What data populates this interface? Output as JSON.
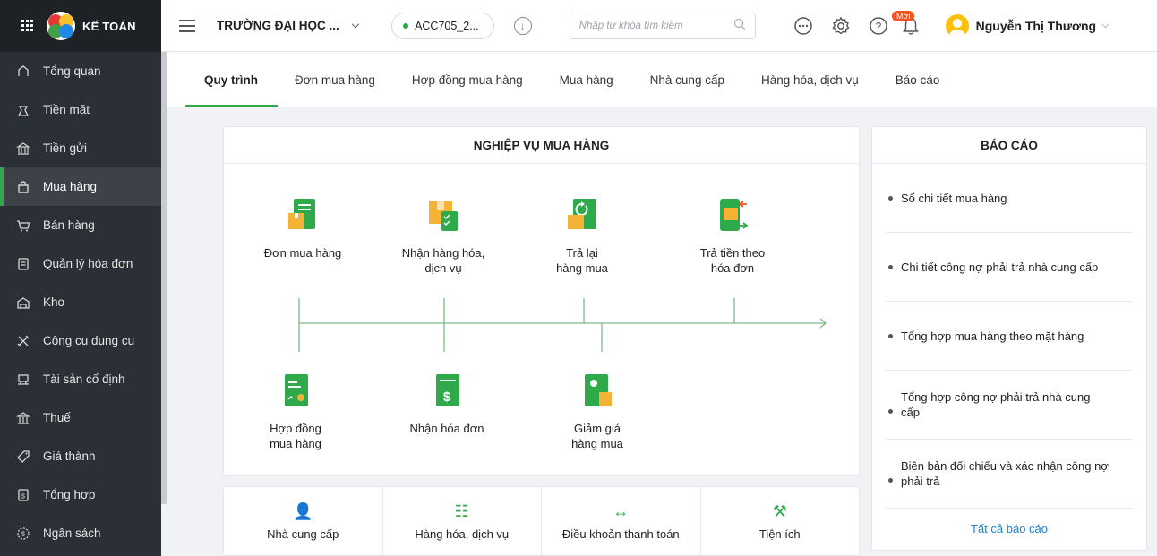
{
  "brand": {
    "title": "KẾ TOÁN"
  },
  "sidebar": {
    "items": [
      {
        "label": "Tổng quan",
        "icon": "overview-icon"
      },
      {
        "label": "Tiền mặt",
        "icon": "cash-icon"
      },
      {
        "label": "Tiền gửi",
        "icon": "bank-icon"
      },
      {
        "label": "Mua hàng",
        "icon": "shopping-bag-icon"
      },
      {
        "label": "Bán hàng",
        "icon": "cart-icon"
      },
      {
        "label": "Quản lý hóa đơn",
        "icon": "invoice-icon"
      },
      {
        "label": "Kho",
        "icon": "warehouse-icon"
      },
      {
        "label": "Công cụ dụng cụ",
        "icon": "tools-icon"
      },
      {
        "label": "Tài sản cố định",
        "icon": "asset-icon"
      },
      {
        "label": "Thuế",
        "icon": "tax-icon"
      },
      {
        "label": "Giá thành",
        "icon": "price-tag-icon"
      },
      {
        "label": "Tổng hợp",
        "icon": "summary-icon"
      },
      {
        "label": "Ngân sách",
        "icon": "budget-icon"
      }
    ]
  },
  "header": {
    "org": "TRƯỜNG ĐẠI HỌC ...",
    "db": "ACC705_2...",
    "search_placeholder": "Nhập từ khóa tìm kiếm",
    "new_badge": "Mới",
    "user": "Nguyễn Thị Thương"
  },
  "tabs": [
    "Quy trình",
    "Đơn mua hàng",
    "Hợp đồng mua hàng",
    "Mua hàng",
    "Nhà cung cấp",
    "Hàng hóa, dịch vụ",
    "Báo cáo"
  ],
  "process": {
    "title": "NGHIỆP VỤ MUA HÀNG",
    "top_steps": [
      {
        "line1": "Đơn mua hàng",
        "line2": ""
      },
      {
        "line1": "Nhận hàng hóa,",
        "line2": "dịch vụ"
      },
      {
        "line1": "Trả lại",
        "line2": "hàng mua"
      },
      {
        "line1": "Trả tiền theo",
        "line2": "hóa đơn"
      }
    ],
    "bottom_steps": [
      {
        "line1": "Hợp đồng",
        "line2": "mua hàng"
      },
      {
        "line1": "Nhận hóa đơn",
        "line2": ""
      },
      {
        "line1": "Giảm giá",
        "line2": "hàng mua"
      }
    ]
  },
  "shortcuts": [
    {
      "label": "Nhà cung cấp",
      "icon": "supplier-icon"
    },
    {
      "label": "Hàng hóa, dịch vụ",
      "icon": "goods-icon"
    },
    {
      "label": "Điều khoản thanh toán",
      "icon": "payment-terms-icon"
    },
    {
      "label": "Tiện ích",
      "icon": "utilities-icon"
    }
  ],
  "report": {
    "title": "BÁO CÁO",
    "items": [
      {
        "line1": "Sổ chi tiết mua hàng",
        "line2": ""
      },
      {
        "line1": "Chi tiết công nợ phải trả nhà cung cấp",
        "line2": ""
      },
      {
        "line1": "Tổng hợp mua hàng theo mặt hàng",
        "line2": ""
      },
      {
        "line1": "Tổng hợp công nợ phải trả nhà cung",
        "line2": "cấp"
      },
      {
        "line1": "Biên bản đối chiếu và xác nhận công nợ",
        "line2": "phải trả"
      }
    ],
    "all": "Tất cả báo cáo"
  },
  "colors": {
    "accent": "#2eaa4a",
    "sidebar": "#2b2f36",
    "link": "#1d7fd1"
  }
}
